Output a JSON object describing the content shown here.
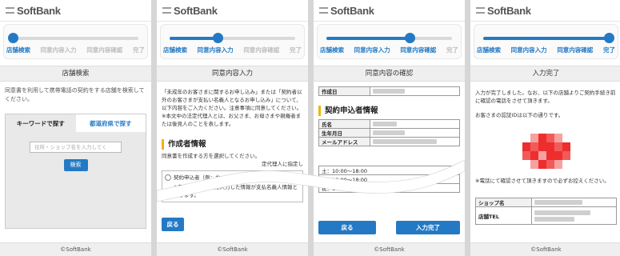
{
  "brand": "SoftBank",
  "footer": "©SoftBank",
  "steps": [
    "店舗検索",
    "同意内容入力",
    "同意内容確認",
    "完了"
  ],
  "progress_levels": [
    0,
    0.38,
    0.66,
    1
  ],
  "colors": {
    "accent": "#2479c4",
    "section_marker": "#f0b400",
    "code_red": "#ee2d2d"
  },
  "screen1": {
    "title": "店舗検索",
    "intro": "同意書を利用して携帯電話の契約をする店舗を検索してください。",
    "tab_keyword": "キーワードで探す",
    "tab_pref": "都道府県で探す",
    "search_placeholder": "住所・ショップ名を入力してく",
    "search_button": "検索"
  },
  "screen2": {
    "title": "同意内容入力",
    "intro1": "「未成年のお客さまに関するお申し込み」または「契約者以外のお客さまが支払い名義人となるお申し込み」について、以下内容をご入力ください。注意事項に同意してください。",
    "intro2": "※本文中の法定代理人とは、お父さま、お母さまや親権者または後見人のことを表します。",
    "section": "作成者情報",
    "select_text": "同意書を作成する方を選択してください。",
    "option_partial": "定代理人に指定し",
    "option2": "契約申込者（例：お",
    "note": "※契約申込者情報に入力した情報が支払名義人情報となります。",
    "back_button": "戻る"
  },
  "screen3": {
    "title": "同意内容の確認",
    "created_label": "作成日",
    "section": "契約申込者情報",
    "row_name": "氏名",
    "row_birth": "生年月日",
    "row_mail": "メールアドレス",
    "hours": [
      "土：10:00〜18:00",
      "日：10:00〜18:00",
      "祝：10:00〜18:00"
    ],
    "back_button": "戻る",
    "done_button": "入力完了"
  },
  "screen4": {
    "title": "入力完了",
    "msg1": "入力が完了しました。なお、以下の店舗よりご契約手続き前に確認の電話をさせて頂きます。",
    "msg2": "お客さまの認証IDは以下の通りです。",
    "note": "※電話にて確認させて頂きますので必ずお控えください。",
    "shop_label": "ショップ名",
    "tel_label": "店舗TEL"
  }
}
